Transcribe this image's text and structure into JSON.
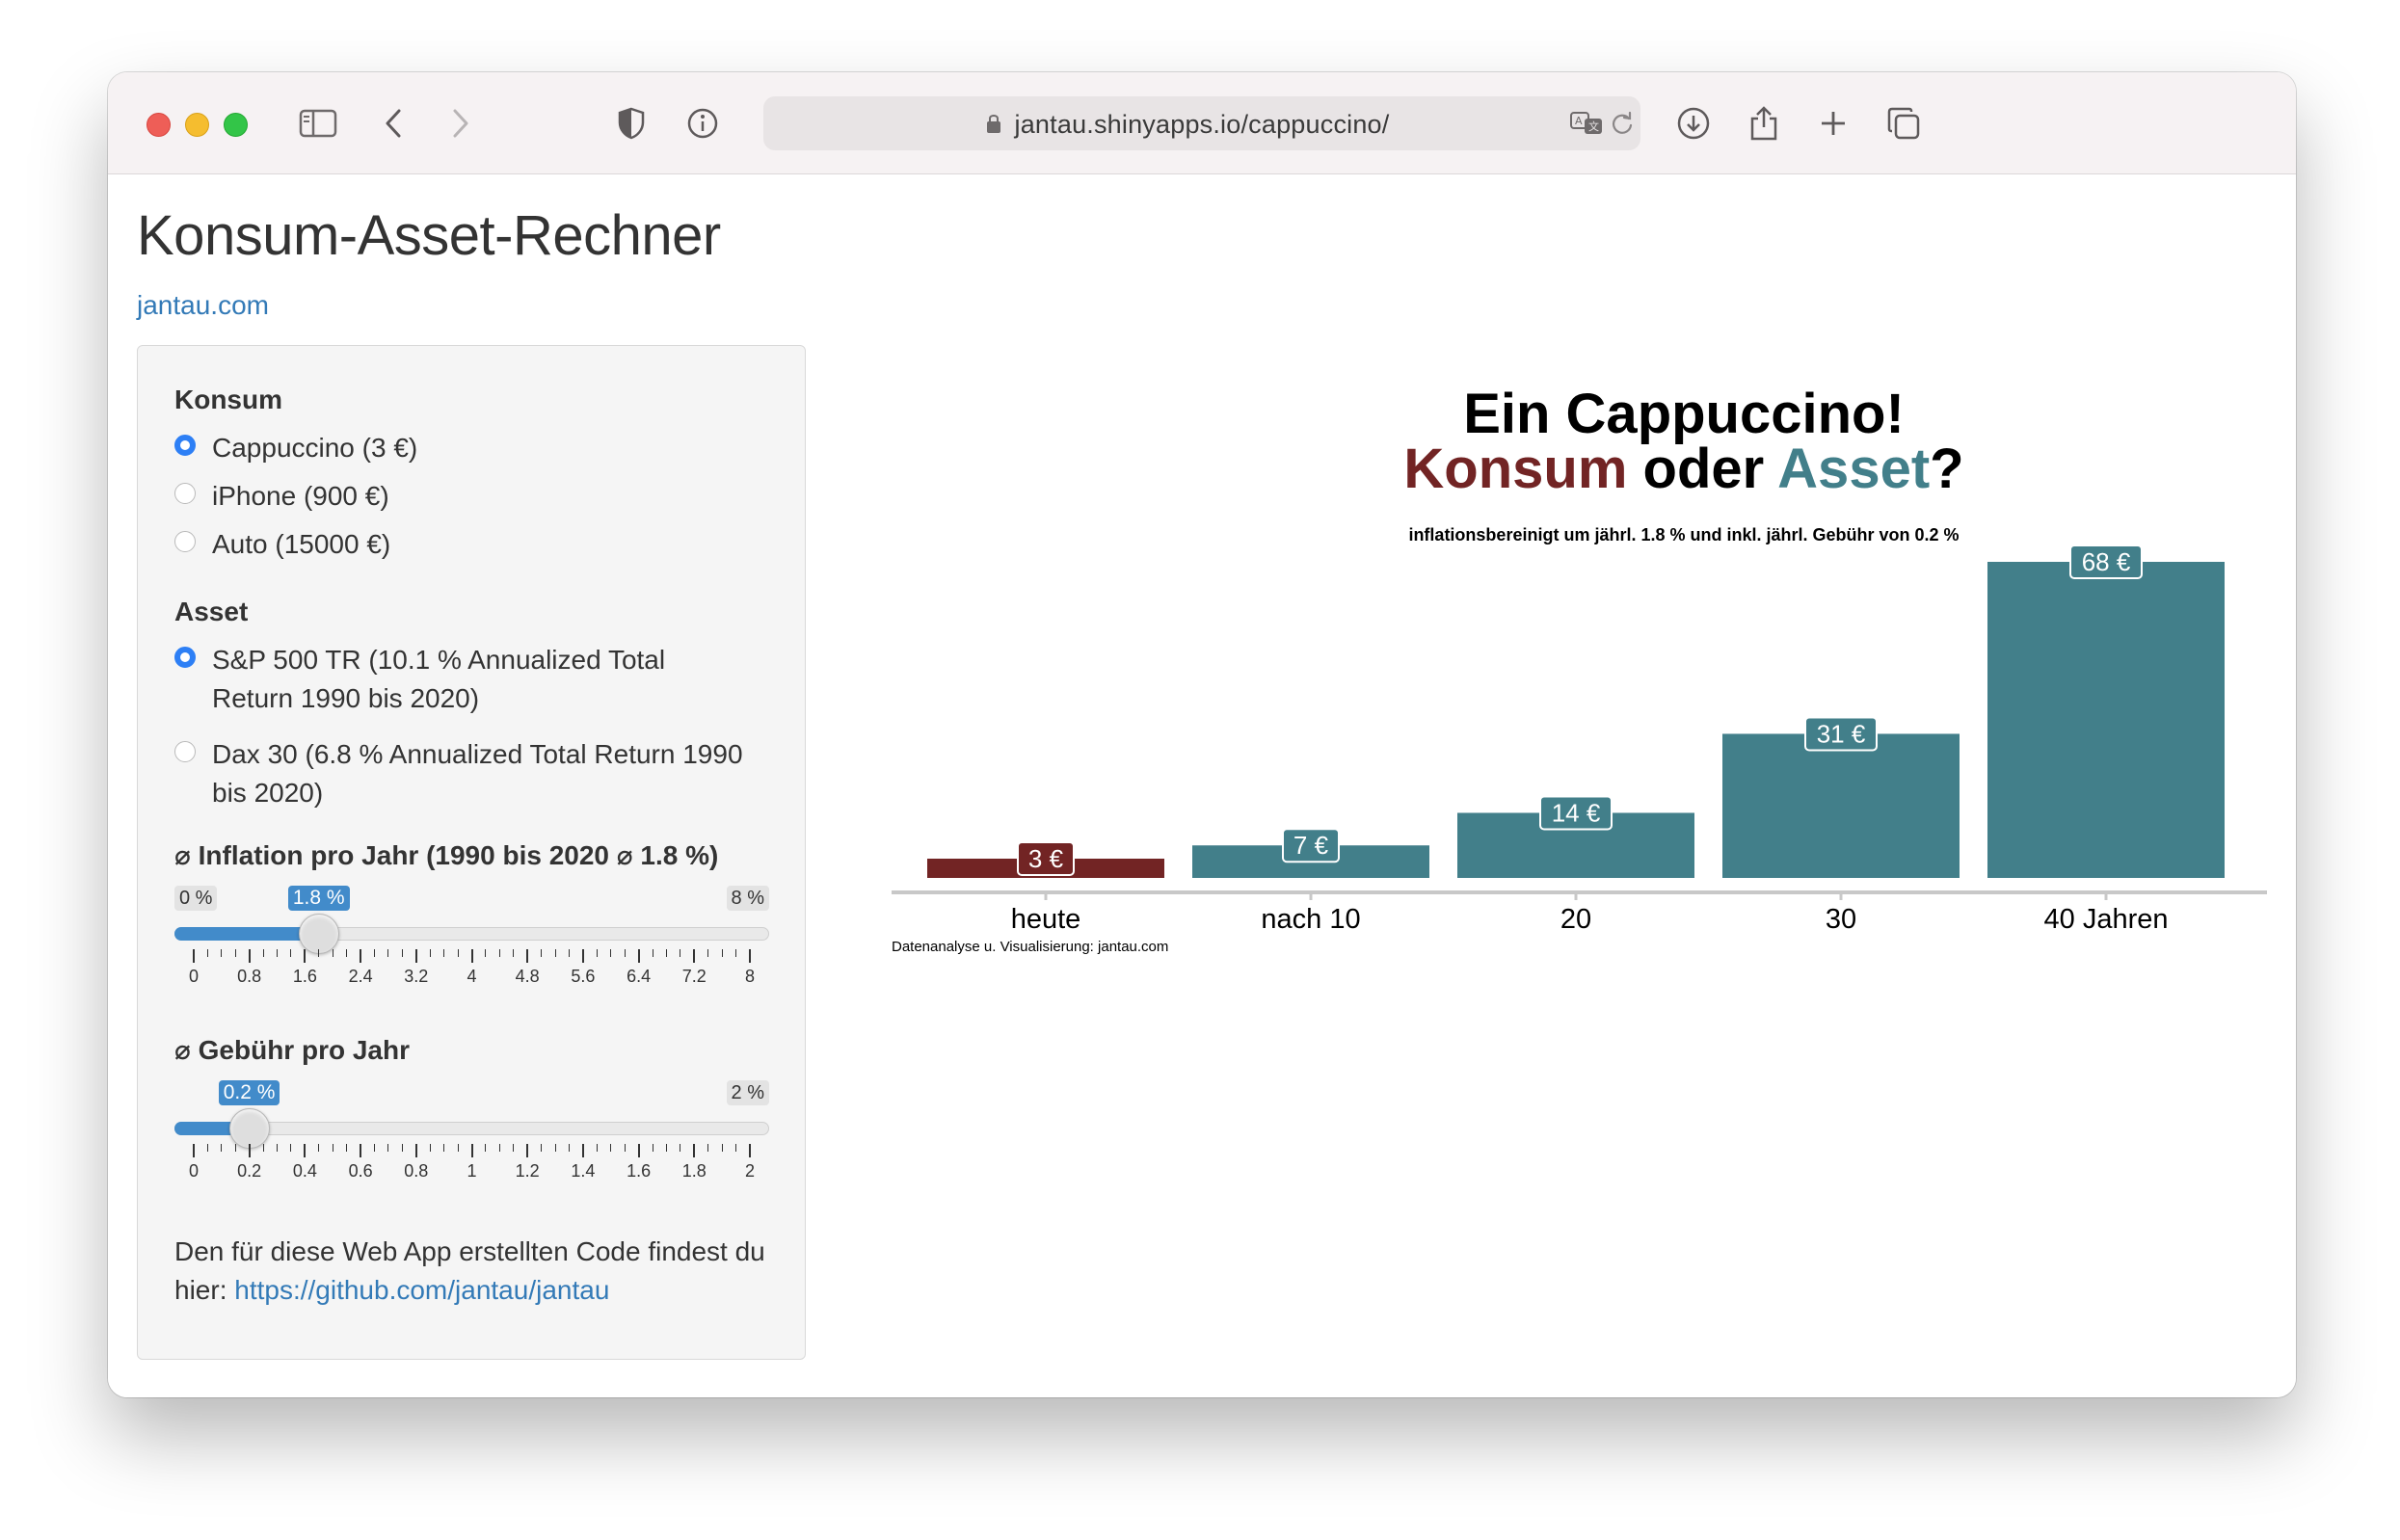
{
  "browser": {
    "url": "jantau.shinyapps.io/cappuccino/"
  },
  "page": {
    "title": "Konsum-Asset-Rechner",
    "site_link": "jantau.com"
  },
  "sidebar": {
    "konsum": {
      "label": "Konsum",
      "options": [
        {
          "label": "Cappuccino (3 €)",
          "selected": true
        },
        {
          "label": "iPhone (900 €)",
          "selected": false
        },
        {
          "label": "Auto (15000 €)",
          "selected": false
        }
      ]
    },
    "asset": {
      "label": "Asset",
      "options": [
        {
          "label": "S&P 500 TR (10.1 % Annualized Total Return 1990 bis 2020)",
          "selected": true
        },
        {
          "label": "Dax 30 (6.8 % Annualized Total Return 1990 bis 2020)",
          "selected": false
        }
      ]
    },
    "inflation": {
      "label": "⌀ Inflation pro Jahr (1990 bis 2020 ⌀ 1.8 %)",
      "min_label": "0 %",
      "max_label": "8 %",
      "value_label": "1.8 %",
      "value": 1.8,
      "min": 0,
      "max": 8,
      "tick_labels": [
        "0",
        "0.8",
        "1.6",
        "2.4",
        "3.2",
        "4",
        "4.8",
        "5.6",
        "6.4",
        "7.2",
        "8"
      ]
    },
    "fee": {
      "label": "⌀ Gebühr pro Jahr",
      "min_label": "0 %",
      "max_label": "2 %",
      "value_label": "0.2 %",
      "value": 0.2,
      "min": 0,
      "max": 2,
      "tick_labels": [
        "0",
        "0.2",
        "0.4",
        "0.6",
        "0.8",
        "1",
        "1.2",
        "1.4",
        "1.6",
        "1.8",
        "2"
      ]
    },
    "footer": {
      "text": "Den für diese Web App erstellten Code findest du hier: ",
      "link": "https://github.com/jantau/jantau"
    }
  },
  "chart_data": {
    "type": "bar",
    "title_line1": "Ein Cappuccino!",
    "title_line2_part1": "Konsum",
    "title_line2_part2": " oder ",
    "title_line2_part3": "Asset",
    "title_line2_part4": "?",
    "subtitle": "inflationsbereinigt um jährl. 1.8 % und inkl. jährl. Gebühr von 0.2 %",
    "caption": "Datenanalyse u. Visualisierung: jantau.com",
    "categories": [
      "heute",
      "nach 10",
      "20",
      "30",
      "40 Jahren"
    ],
    "values": [
      3,
      7,
      14,
      31,
      68
    ],
    "value_labels": [
      "3 €",
      "7 €",
      "14 €",
      "31 €",
      "68 €"
    ],
    "colors": {
      "konsum": "#722424",
      "asset": "#427f8a"
    },
    "ylim": [
      0,
      68
    ],
    "grid": false,
    "legend": "none"
  }
}
